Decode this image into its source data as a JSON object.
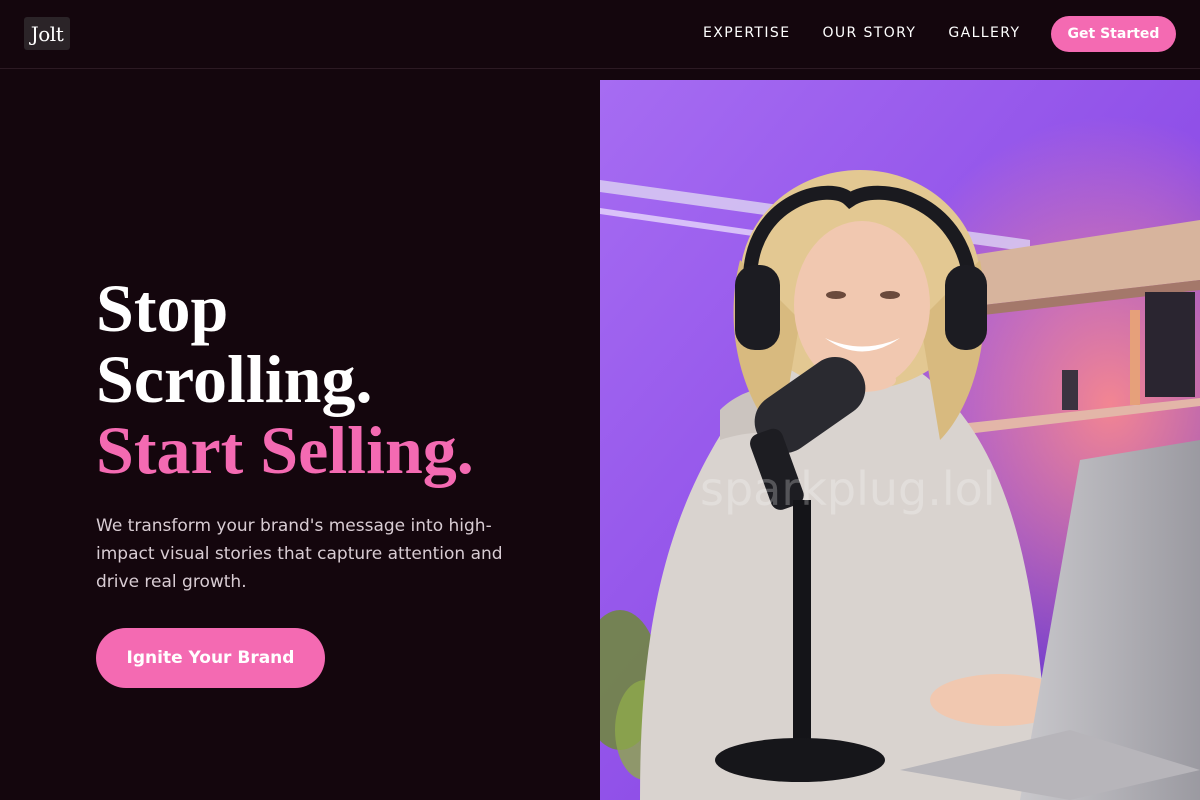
{
  "header": {
    "logo": "Jolt",
    "nav": [
      "EXPERTISE",
      "OUR STORY",
      "GALLERY"
    ],
    "cta": "Get Started"
  },
  "hero": {
    "headline_line1": "Stop",
    "headline_line2": "Scrolling.",
    "headline_accent": "Start Selling.",
    "description": "We transform your brand's message into high-impact visual stories that capture attention and drive real growth.",
    "cta": "Ignite Your Brand",
    "watermark": "sparkplug.lol"
  },
  "colors": {
    "background": "#14060d",
    "accent": "#f46ab2",
    "text_muted": "#d8ccd3"
  }
}
